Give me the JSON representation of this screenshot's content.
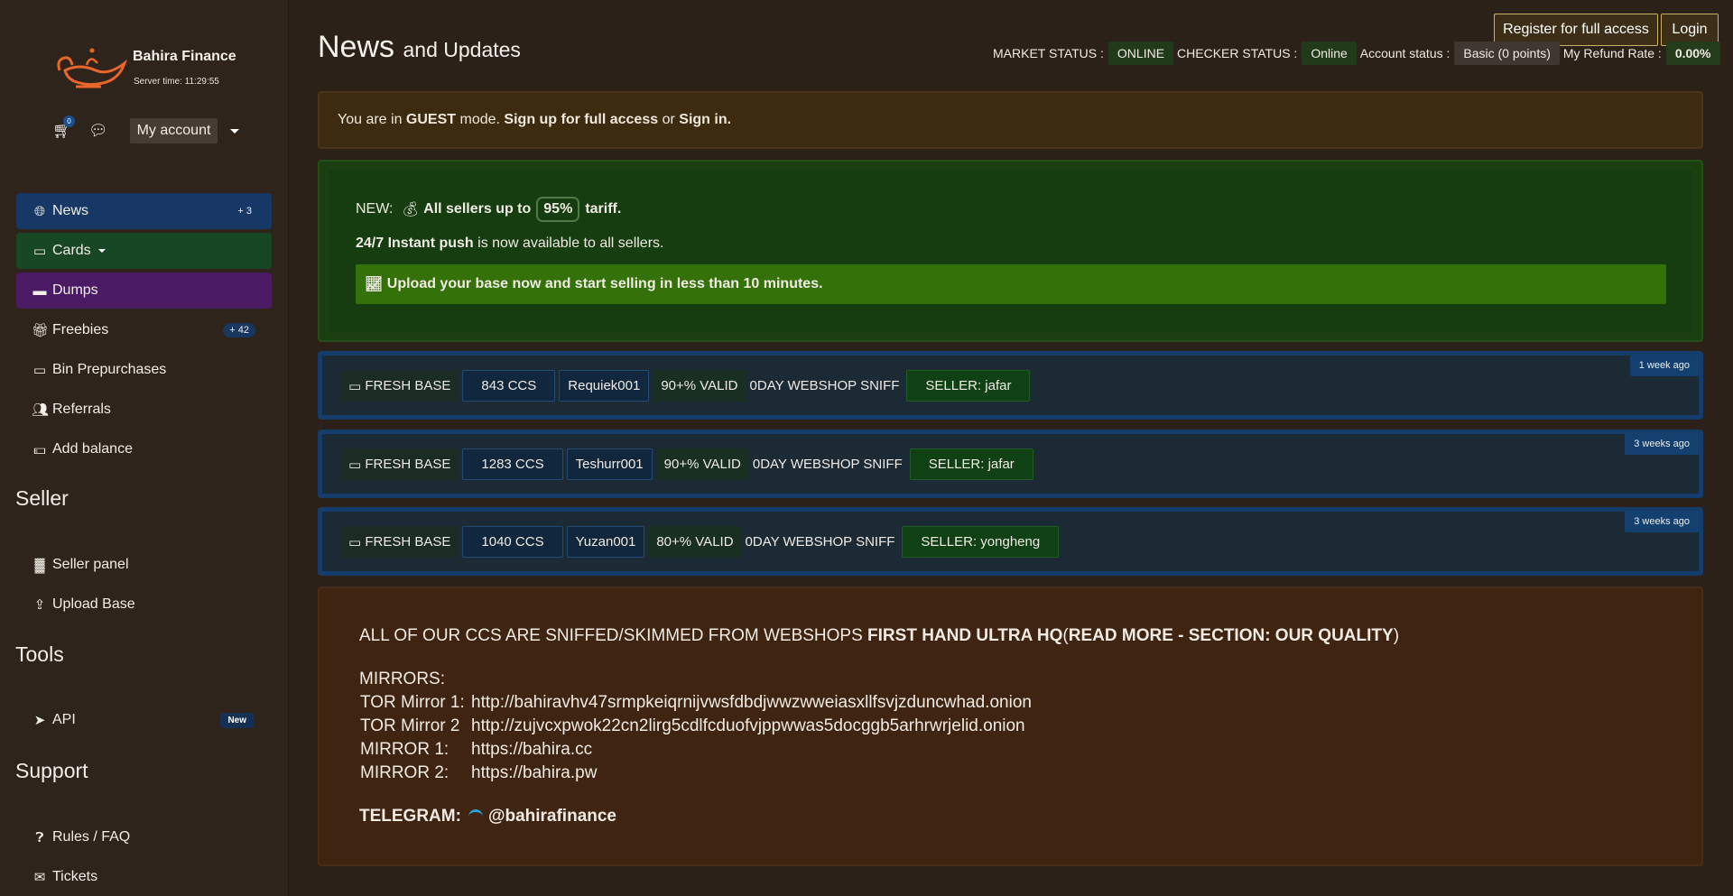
{
  "brand": {
    "name": "Bahira Finance",
    "server_time": "Server time: 11:29:55"
  },
  "account": {
    "cart_count": "0",
    "my_account_label": "My account"
  },
  "sidebar": {
    "items": [
      {
        "label": "News",
        "count": "+ 3"
      },
      {
        "label": "Cards"
      },
      {
        "label": "Dumps"
      },
      {
        "label": "Freebies",
        "count": "+ 42"
      },
      {
        "label": "Bin Prepurchases"
      },
      {
        "label": "Referrals"
      },
      {
        "label": "Add balance"
      }
    ],
    "seller_heading": "Seller",
    "seller_items": [
      {
        "label": "Seller panel"
      },
      {
        "label": "Upload Base"
      }
    ],
    "tools_heading": "Tools",
    "tools_items": [
      {
        "label": "API",
        "badge": "New"
      }
    ],
    "support_heading": "Support",
    "support_items": [
      {
        "label": "Rules / FAQ"
      },
      {
        "label": "Tickets"
      }
    ]
  },
  "header": {
    "title": "News",
    "subtitle": "and Updates",
    "market_status_label": "MARKET STATUS :",
    "market_status": "ONLINE",
    "checker_status_label": "CHECKER STATUS :",
    "checker_status": "Online",
    "account_status_label": "Account status :",
    "account_status": "Basic (0 points)",
    "refund_rate_label": "My Refund Rate :",
    "refund_rate": "0.00%",
    "register_label": "Register for full access",
    "login_label": "Login"
  },
  "guest": {
    "prefix": "You are in",
    "mode": "GUEST",
    "middle": "mode.",
    "signup": "Sign up for full access",
    "or": "or",
    "signin": "Sign in",
    "end": "."
  },
  "promo": {
    "new_label": "NEW:",
    "line1_a": "All sellers up to",
    "percent": "95%",
    "line1_b": "tariff.",
    "line2_bold": "24/7 Instant push",
    "line2_rest": "is now available to all sellers.",
    "bar": "Upload your base now and start selling in less than 10 minutes."
  },
  "bases": [
    {
      "type": "FRESH BASE",
      "ccs": "843 CCS",
      "name": "Requiek001",
      "valid": "90+% VALID",
      "source": "0DAY WEBSHOP SNIFF",
      "seller": "SELLER: jafar",
      "time": "1 week ago"
    },
    {
      "type": "FRESH BASE",
      "ccs": "1283 CCS",
      "name": "Teshurr001",
      "valid": "90+% VALID",
      "source": "0DAY WEBSHOP SNIFF",
      "seller": "SELLER: jafar",
      "time": "3 weeks ago"
    },
    {
      "type": "FRESH BASE",
      "ccs": "1040 CCS",
      "name": "Yuzan001",
      "valid": "80+% VALID",
      "source": "0DAY WEBSHOP SNIFF",
      "seller": "SELLER: yongheng",
      "time": "3 weeks ago"
    }
  ],
  "info": {
    "quality_a": "ALL OF OUR CCS ARE SNIFFED/SKIMMED FROM WEBSHOPS",
    "quality_b": "FIRST HAND ULTRA HQ",
    "quality_c": "(",
    "quality_d": "READ MORE - SECTION: OUR QUALITY",
    "quality_e": ")",
    "mirrors_heading": "MIRRORS:",
    "mirrors": [
      {
        "label": "TOR Mirror 1:",
        "url": "http://bahiravhv47srmpkeiqrnijvwsfdbdjwwzwweiasxllfsvjzduncwhad.onion"
      },
      {
        "label": "TOR Mirror 2",
        "url": "http://zujvcxpwok22cn2lirg5cdlfcduofvjppwwas5docggb5arhrwrjelid.onion"
      },
      {
        "label": "MIRROR 1:",
        "url": "https://bahira.cc"
      },
      {
        "label": "MIRROR 2:",
        "url": "https://bahira.pw"
      }
    ],
    "telegram_label": "TELEGRAM:",
    "telegram_handle": "@bahirafinance"
  },
  "colors": {
    "accent_news": "#173866",
    "accent_cards": "#174724",
    "accent_dumps": "#4a1a64",
    "promo_bar": "#347209"
  }
}
